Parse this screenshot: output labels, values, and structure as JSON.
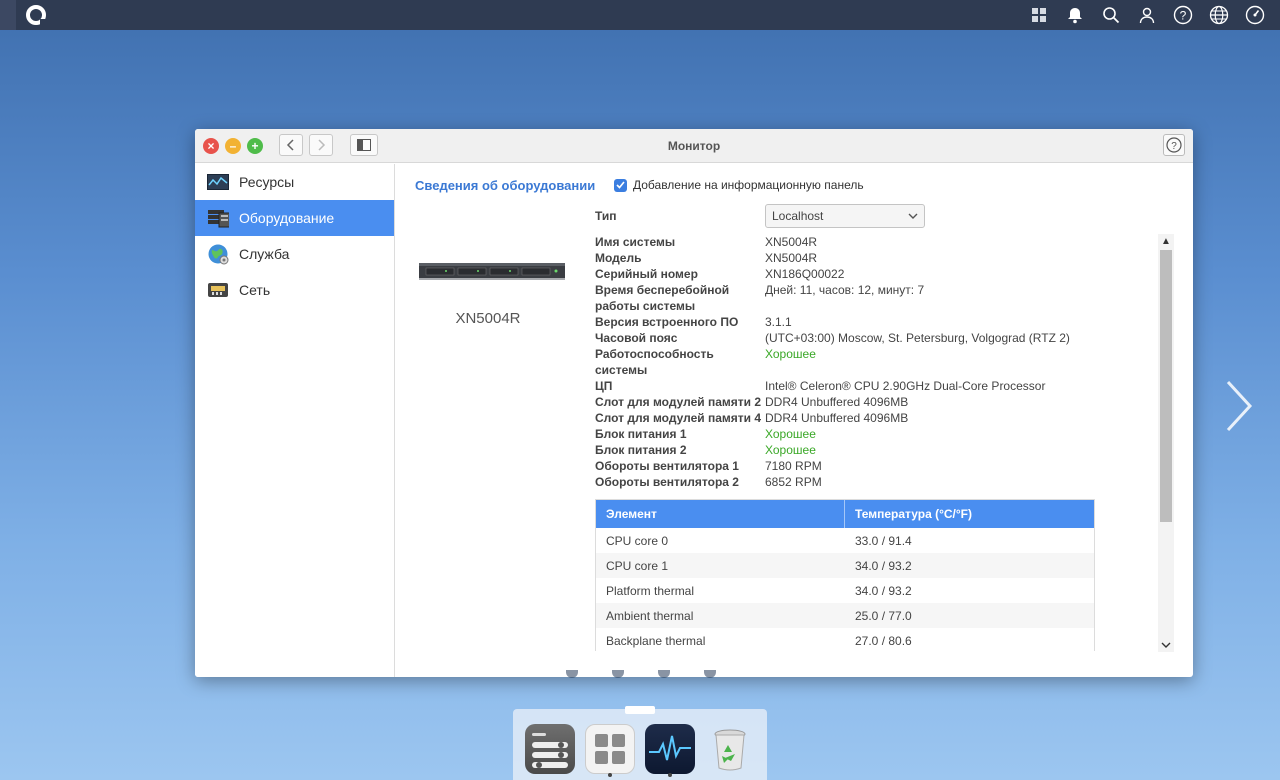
{
  "window": {
    "title": "Монитор"
  },
  "sidebar": {
    "items": [
      {
        "label": "Ресурсы",
        "icon": "chart-line-icon"
      },
      {
        "label": "Оборудование",
        "icon": "hardware-icon"
      },
      {
        "label": "Служба",
        "icon": "globe-service-icon"
      },
      {
        "label": "Сеть",
        "icon": "network-icon"
      }
    ],
    "active_index": 1
  },
  "main": {
    "section_title": "Сведения об оборудовании",
    "checkbox_label": "Добавление на информационную панель",
    "checkbox_checked": true,
    "device_name": "XN5004R",
    "type_label": "Тип",
    "type_value": "Localhost",
    "info": [
      {
        "k": "Имя системы",
        "v": "XN5004R"
      },
      {
        "k": "Модель",
        "v": "XN5004R"
      },
      {
        "k": "Серийный номер",
        "v": "XN186Q00022"
      },
      {
        "k": "Время бесперебойной",
        "k2": "работы системы",
        "v": "Дней: 11, часов: 12, минут: 7"
      },
      {
        "k": "Версия встроенного ПО",
        "v": "3.1.1"
      },
      {
        "k": "Часовой пояс",
        "v": "(UTC+03:00) Moscow, St. Petersburg, Volgograd (RTZ 2)"
      },
      {
        "k": "Работоспособность",
        "k2": "системы",
        "v": "Хорошее",
        "status": "good"
      },
      {
        "k": "ЦП",
        "v": "Intel® Celeron® CPU 2.90GHz Dual-Core Processor"
      },
      {
        "k": "Слот для модулей памяти 2",
        "v": "DDR4 Unbuffered 4096MB"
      },
      {
        "k": "Слот для модулей памяти 4",
        "v": "DDR4 Unbuffered 4096MB"
      },
      {
        "k": "Блок питания 1",
        "v": "Хорошее",
        "status": "good"
      },
      {
        "k": "Блок питания 2",
        "v": "Хорошее",
        "status": "good"
      },
      {
        "k": "Обороты вентилятора 1",
        "v": "7180 RPM"
      },
      {
        "k": "Обороты вентилятора 2",
        "v": "6852 RPM"
      }
    ],
    "table": {
      "headers": [
        "Элемент",
        "Температура (°C/°F)"
      ],
      "rows": [
        [
          "CPU core 0",
          "33.0 / 91.4"
        ],
        [
          "CPU core 1",
          "34.0 / 93.2"
        ],
        [
          "Platform thermal",
          "34.0 / 93.2"
        ],
        [
          "Ambient thermal",
          "25.0 / 77.0"
        ],
        [
          "Backplane thermal",
          "27.0 / 80.6"
        ]
      ]
    }
  },
  "topbar": {
    "icons": [
      "apps-grid-icon",
      "bell-icon",
      "search-icon",
      "user-icon",
      "help-icon",
      "globe-icon",
      "dashboard-gauge-icon"
    ]
  },
  "dock": {
    "apps": [
      "control-panel-icon",
      "app-center-icon",
      "monitor-icon",
      "recycle-bin-icon"
    ]
  },
  "colors": {
    "accent": "#4a8ef0",
    "good": "#3aa827",
    "section_title": "#3b79d4"
  }
}
